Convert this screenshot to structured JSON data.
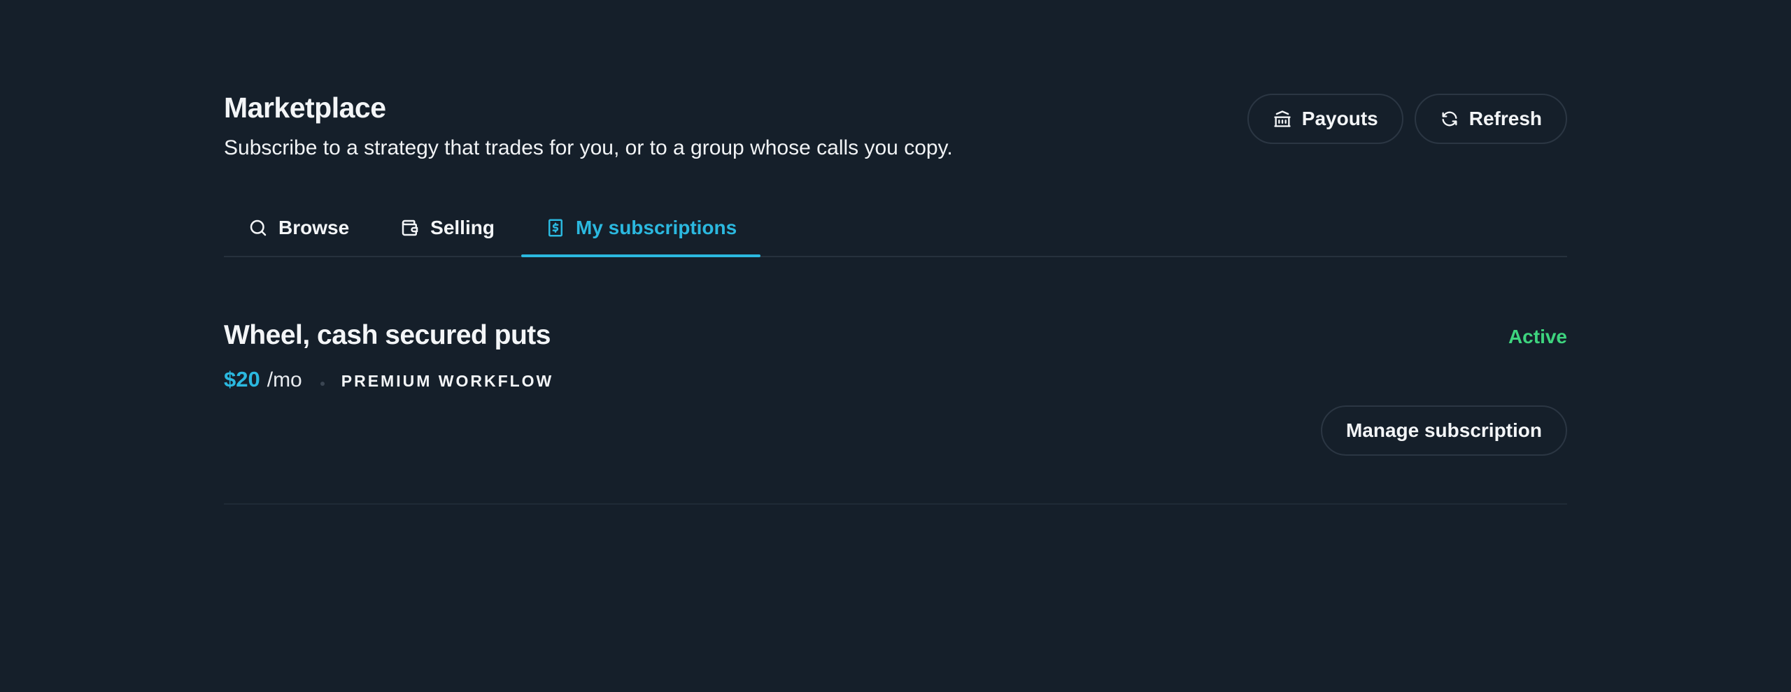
{
  "header": {
    "title": "Marketplace",
    "subtitle": "Subscribe to a strategy that trades for you, or to a group whose calls you copy.",
    "actions": [
      {
        "label": "Payouts",
        "icon": "bank-icon"
      },
      {
        "label": "Refresh",
        "icon": "refresh-icon"
      }
    ]
  },
  "tabs": [
    {
      "label": "Browse",
      "icon": "search-icon",
      "active": false
    },
    {
      "label": "Selling",
      "icon": "wallet-icon",
      "active": false
    },
    {
      "label": "My subscriptions",
      "icon": "receipt-icon",
      "active": true
    }
  ],
  "subscriptions": [
    {
      "title": "Wheel, cash secured puts",
      "status": "Active",
      "price": "$20",
      "period": "/mo",
      "tag": "PREMIUM WORKFLOW",
      "manage_label": "Manage subscription"
    }
  ],
  "colors": {
    "background": "#151f2a",
    "accent": "#2bb8df",
    "status_active": "#3ed47e",
    "border": "#2b3643"
  }
}
